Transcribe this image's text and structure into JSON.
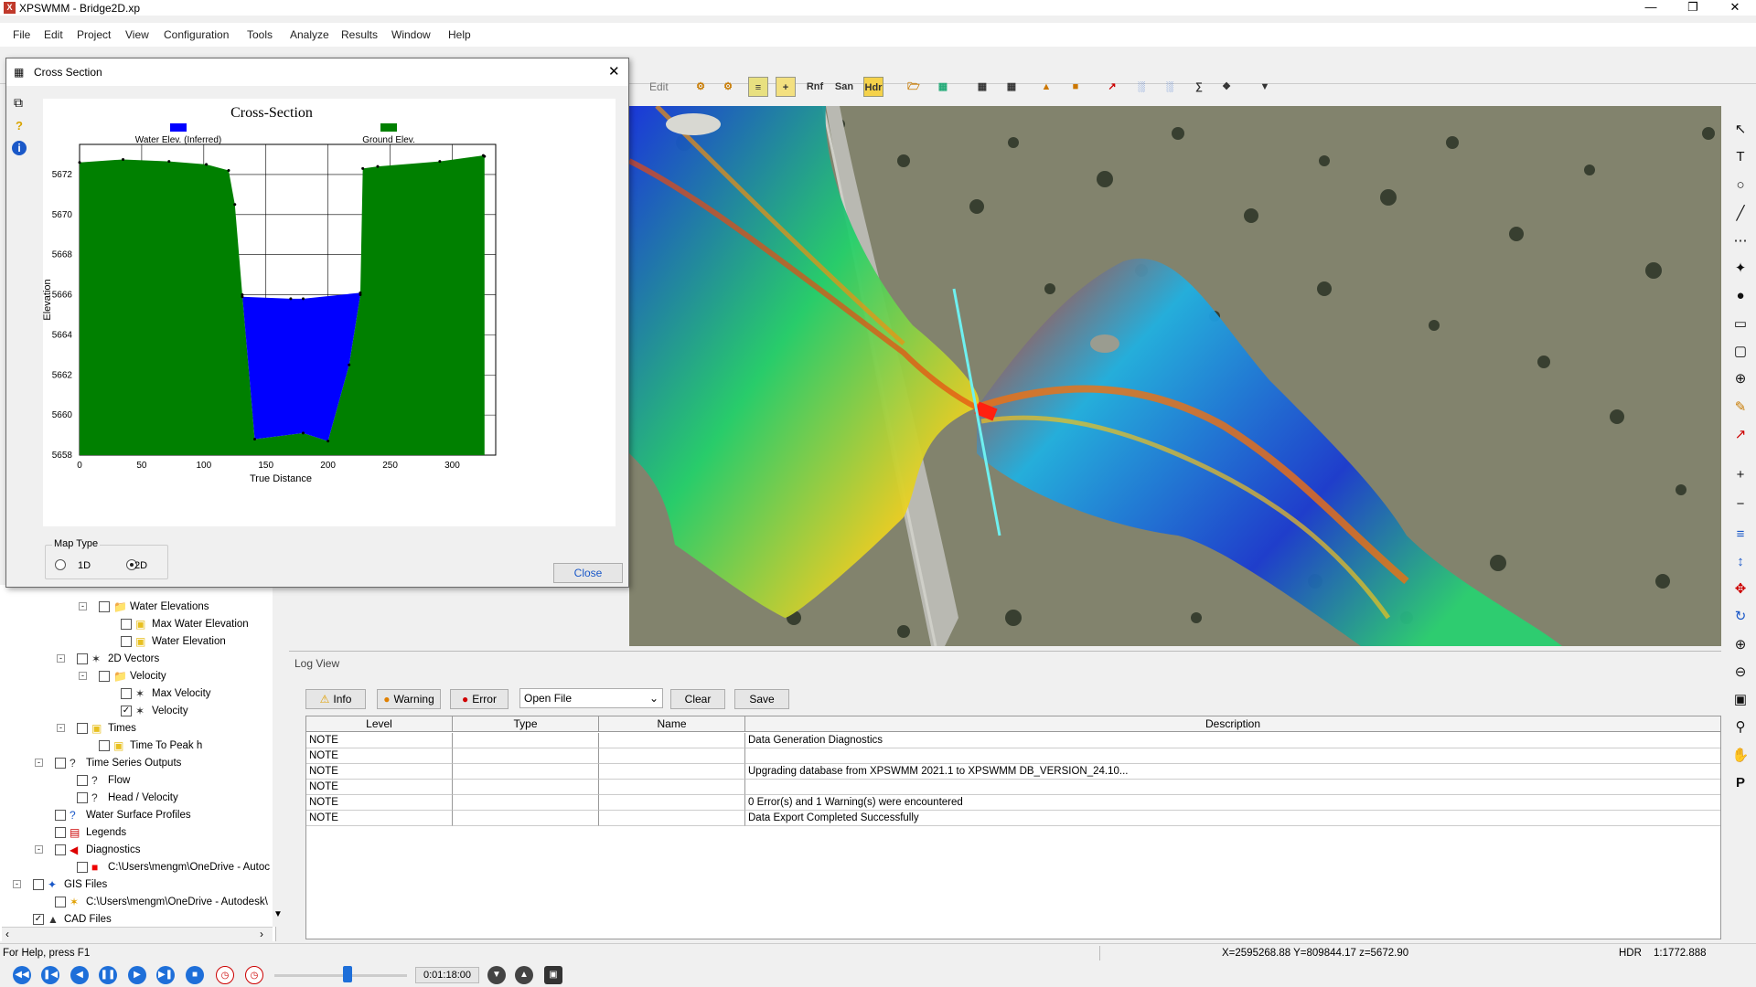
{
  "app": {
    "title": "XPSWMM - Bridge2D.xp",
    "min": "—",
    "max": "❐",
    "close": "✕"
  },
  "menu": [
    "File",
    "Edit",
    "Project",
    "View",
    "Configuration",
    "Tools",
    "Analyze",
    "Results",
    "Window",
    "Help"
  ],
  "toolbar": {
    "edit_label": "Edit",
    "rnf": "Rnf",
    "san": "San",
    "hdr": "Hdr"
  },
  "dialog": {
    "title": "Cross Section",
    "close_icon": "✕",
    "map_type_label": "Map Type",
    "option_1d": "1D",
    "option_2d": "2D",
    "selected": "2D",
    "close_button": "Close"
  },
  "chart_data": {
    "type": "area",
    "title": "Cross-Section",
    "xlabel": "True Distance",
    "ylabel": "Elevation",
    "xlim": [
      0,
      335
    ],
    "ylim": [
      5658,
      5673.5
    ],
    "xticks": [
      0,
      50,
      100,
      150,
      200,
      250,
      300
    ],
    "yticks": [
      5658,
      5660,
      5662,
      5664,
      5666,
      5668,
      5670,
      5672
    ],
    "grid": true,
    "legend": [
      {
        "name": "Water Elev. (Inferred)",
        "color": "#0000ff"
      },
      {
        "name": "Ground Elev.",
        "color": "#008000"
      }
    ],
    "series": [
      {
        "name": "Ground Elev.",
        "color": "#008000",
        "x": [
          0,
          35,
          72,
          102,
          120,
          125,
          131,
          141,
          180,
          200,
          217,
          226,
          228,
          240,
          290,
          325,
          326
        ],
        "y": [
          5672.6,
          5672.75,
          5672.65,
          5672.5,
          5672.2,
          5670.5,
          5666.0,
          5658.8,
          5659.1,
          5658.7,
          5662.5,
          5666.0,
          5672.3,
          5672.4,
          5672.65,
          5672.95,
          5672.9
        ]
      },
      {
        "name": "Water Elev. (Inferred)",
        "color": "#0000ff",
        "x": [
          131,
          170,
          180,
          226
        ],
        "y": [
          5665.9,
          5665.8,
          5665.8,
          5666.1
        ]
      }
    ]
  },
  "tree": [
    {
      "label": "Water Elevations",
      "level": 4,
      "icon": "folder-icon",
      "checked": false,
      "expander": "-"
    },
    {
      "label": "Max Water Elevation",
      "level": 5,
      "icon": "raster-icon",
      "checked": false
    },
    {
      "label": "Water Elevation",
      "level": 5,
      "icon": "raster-icon",
      "checked": false
    },
    {
      "label": "2D Vectors",
      "level": 3,
      "icon": "vectors-icon",
      "checked": false,
      "expander": "-"
    },
    {
      "label": "Velocity",
      "level": 4,
      "icon": "folder-icon",
      "checked": false,
      "expander": "-"
    },
    {
      "label": "Max Velocity",
      "level": 5,
      "icon": "vectors-icon",
      "checked": false
    },
    {
      "label": "Velocity",
      "level": 5,
      "icon": "vectors-icon",
      "checked": true
    },
    {
      "label": "Times",
      "level": 3,
      "icon": "raster-icon",
      "checked": false,
      "expander": "-"
    },
    {
      "label": "Time To Peak h",
      "level": 4,
      "icon": "raster-icon",
      "checked": false
    },
    {
      "label": "Time Series Outputs",
      "level": 2,
      "icon": "timeseries-icon",
      "checked": false,
      "expander": "-"
    },
    {
      "label": "Flow",
      "level": 3,
      "icon": "timeseries-icon",
      "checked": false
    },
    {
      "label": "Head / Velocity",
      "level": 3,
      "icon": "timeseries-icon",
      "checked": false
    },
    {
      "label": "Water Surface Profiles",
      "level": 2,
      "icon": "profile-icon",
      "checked": false
    },
    {
      "label": "Legends",
      "level": 2,
      "icon": "legend-icon",
      "checked": false
    },
    {
      "label": "Diagnostics",
      "level": 2,
      "icon": "diagnostics-icon",
      "checked": false,
      "expander": "-"
    },
    {
      "label": "C:\\Users\\mengm\\OneDrive - Autoc",
      "level": 3,
      "icon": "red-square-icon",
      "checked": false
    },
    {
      "label": "GIS Files",
      "level": 1,
      "icon": "gis-icon",
      "checked": false,
      "expander": "-"
    },
    {
      "label": "C:\\Users\\mengm\\OneDrive - Autodesk\\",
      "level": 2,
      "icon": "star-icon",
      "checked": false
    },
    {
      "label": "CAD Files",
      "level": 1,
      "icon": "cad-icon",
      "checked": true
    }
  ],
  "log": {
    "title": "Log View",
    "info": "Info",
    "warning": "Warning",
    "error": "Error",
    "dropdown": "Open File",
    "clear": "Clear",
    "save": "Save",
    "columns": [
      "Level",
      "Type",
      "Name",
      "Description"
    ],
    "rows": [
      [
        "NOTE",
        "",
        "",
        "Data Generation Diagnostics"
      ],
      [
        "NOTE",
        "",
        "",
        ""
      ],
      [
        "NOTE",
        "",
        "",
        "Upgrading database from XPSWMM 2021.1 to XPSWMM DB_VERSION_24.10..."
      ],
      [
        "NOTE",
        "",
        "",
        ""
      ],
      [
        "NOTE",
        "",
        "",
        "0 Error(s) and 1 Warning(s) were encountered"
      ],
      [
        "NOTE",
        "",
        "",
        "Data Export Completed Successfully"
      ]
    ]
  },
  "status": {
    "help": "For Help, press F1",
    "coords": "X=2595268.88  Y=809844.17  z=5672.90",
    "hdr": "HDR",
    "scale": "1:1772.888"
  },
  "playback": {
    "time": "0:01:18:00",
    "progress": 0.55
  }
}
